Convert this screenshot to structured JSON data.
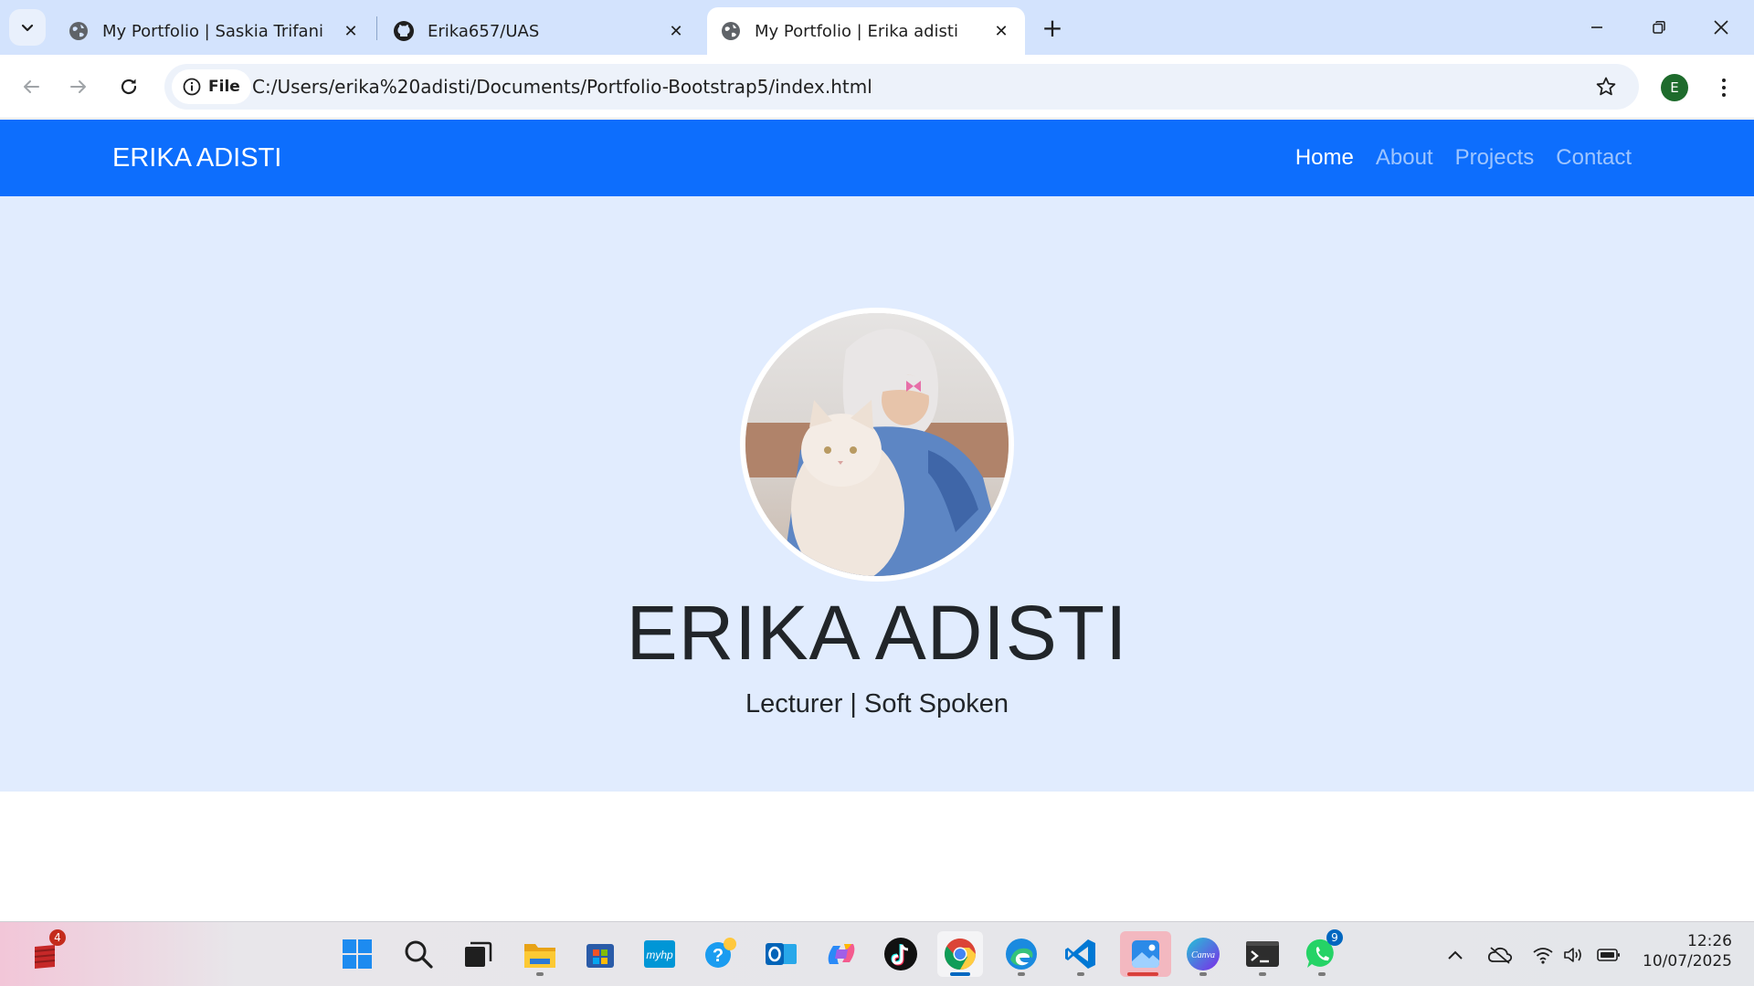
{
  "browser": {
    "tabs": [
      {
        "title": "My Portfolio | Saskia Trifani",
        "favicon": "globe-icon",
        "active": false
      },
      {
        "title": "Erika657/UAS",
        "favicon": "github-icon",
        "active": false
      },
      {
        "title": "My Portfolio | Erika adisti",
        "favicon": "globe-icon",
        "active": true
      }
    ],
    "close_glyph": "✕",
    "new_tab_glyph": "+",
    "security_chip": "File",
    "url": "C:/Users/erika%20adisti/Documents/Portfolio-Bootstrap5/index.html",
    "profile_initial": "E"
  },
  "site": {
    "brand": "ERIKA ADISTI",
    "nav": [
      {
        "label": "Home",
        "active": true
      },
      {
        "label": "About",
        "active": false
      },
      {
        "label": "Projects",
        "active": false
      },
      {
        "label": "Contact",
        "active": false
      }
    ],
    "hero": {
      "name": "ERIKA ADISTI",
      "tagline": "Lecturer | Soft Spoken"
    }
  },
  "taskbar": {
    "widget_badge": "4",
    "whatsapp_badge": "9",
    "apps": [
      "start-icon",
      "search-icon",
      "task-view-icon",
      "file-explorer-icon",
      "microsoft-store-icon",
      "myhp-icon",
      "get-help-icon",
      "outlook-icon",
      "copilot-icon",
      "tiktok-icon",
      "chrome-icon",
      "edge-icon",
      "vscode-icon",
      "photos-icon",
      "canva-icon",
      "terminal-icon",
      "whatsapp-icon"
    ],
    "myhp_label": "myhp",
    "canva_label": "Canva",
    "time": "12:26",
    "date": "10/07/2025"
  },
  "colors": {
    "navbar": "#0d6efd",
    "hero_bg": "#e1ecfe",
    "tabstrip": "#d3e3fd"
  }
}
